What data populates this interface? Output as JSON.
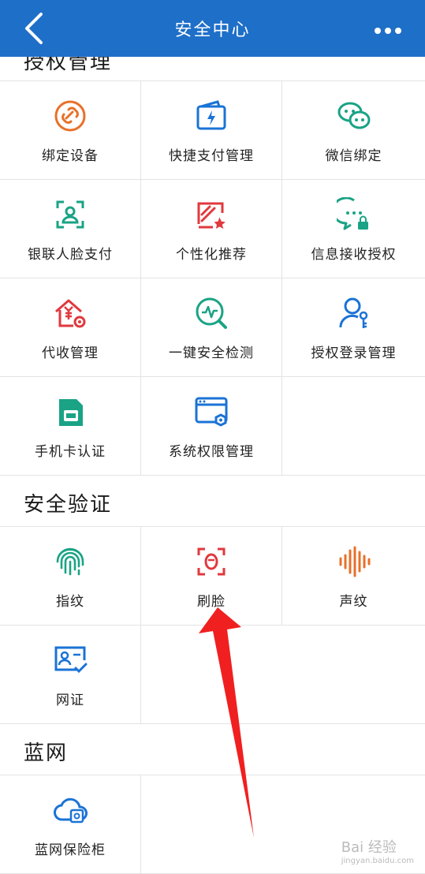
{
  "header": {
    "title": "安全中心"
  },
  "sections": {
    "auth": {
      "title": "授权管理"
    },
    "verify": {
      "title": "安全验证"
    },
    "blue": {
      "title": "蓝网"
    }
  },
  "cells": {
    "bind_device": "绑定设备",
    "quick_pay": "快捷支付管理",
    "wechat_bind": "微信绑定",
    "unionpay_face": "银联人脸支付",
    "personalized": "个性化推荐",
    "msg_auth": "信息接收授权",
    "collect_mgmt": "代收管理",
    "one_key_check": "一键安全检测",
    "login_auth": "授权登录管理",
    "sim_auth": "手机卡认证",
    "sys_perm": "系统权限管理",
    "fingerprint": "指纹",
    "face": "刷脸",
    "voice": "声纹",
    "net_id": "网证",
    "safe_box": "蓝网保险柜"
  },
  "watermark": {
    "brand": "Bai 经验",
    "url": "jingyan.baidu.com"
  },
  "colors": {
    "header": "#1e6fc8",
    "orange": "#e8702a",
    "blue": "#1a73d6",
    "green": "#1aa385",
    "red": "#e0393e"
  }
}
